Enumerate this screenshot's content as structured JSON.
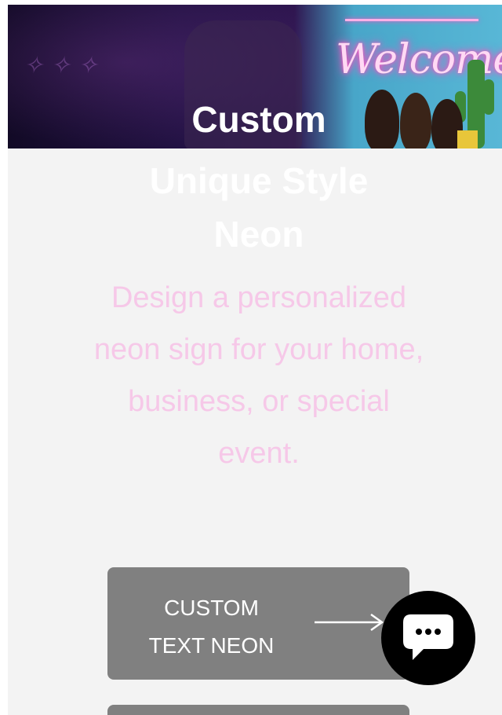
{
  "hero": {
    "title": "Custom",
    "neon_sign": "Welcome"
  },
  "headline": {
    "line1": "Unique Style",
    "line2": "Neon"
  },
  "description": "Design a personalized neon sign for your home, business, or special event.",
  "cta": {
    "label_line1": "CUSTOM",
    "label_line2": "TEXT NEON",
    "icon": "arrow-right-icon"
  },
  "chat": {
    "icon": "chat-bubble-icon"
  },
  "colors": {
    "page_background": "#f3f3f3",
    "headline_text": "#ffffff",
    "description_text": "#f6c8e8",
    "button_background": "#808080",
    "button_text": "#ffffff",
    "chat_button_background": "#000000"
  }
}
